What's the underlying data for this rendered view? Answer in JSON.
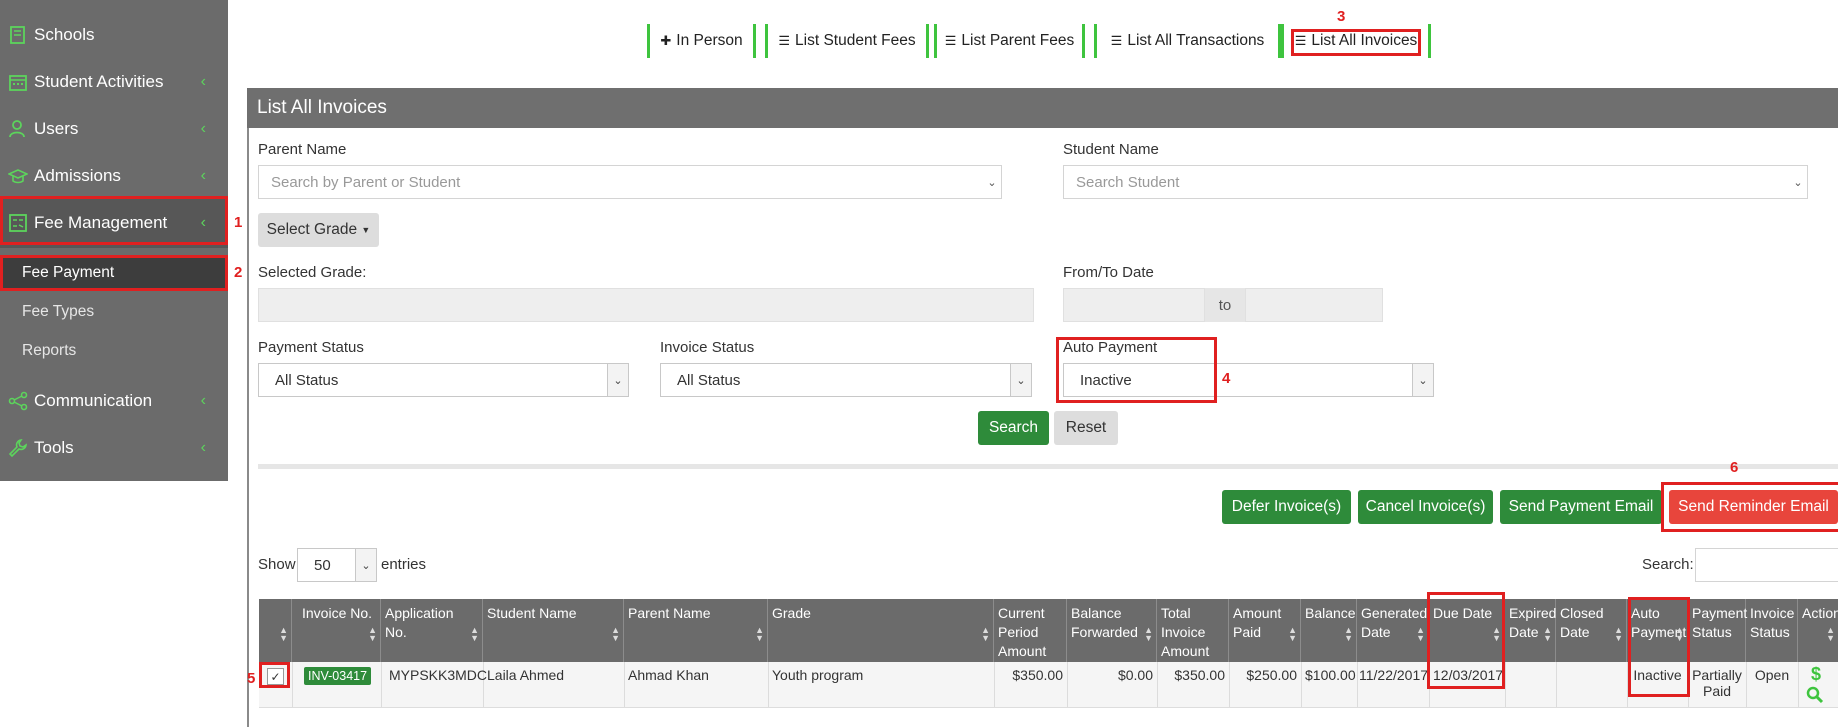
{
  "sidebar": {
    "items": [
      {
        "label": "Schools",
        "icon": "school-icon"
      },
      {
        "label": "Student Activities",
        "icon": "calendar-icon"
      },
      {
        "label": "Users",
        "icon": "users-icon"
      },
      {
        "label": "Admissions",
        "icon": "graduation-cap-icon"
      },
      {
        "label": "Fee Management",
        "icon": "calculator-icon"
      },
      {
        "label": "Communication",
        "icon": "share-icon"
      },
      {
        "label": "Tools",
        "icon": "wrench-icon"
      }
    ],
    "sub_items": [
      "Fee Payment",
      "Fee Types",
      "Reports"
    ]
  },
  "tabs": [
    "In Person",
    "List Student Fees",
    "List Parent Fees",
    "List All Transactions",
    "List All Invoices"
  ],
  "panel_title": "List All Invoices",
  "filters": {
    "parent_name_label": "Parent Name",
    "parent_name_placeholder": "Search by Parent or Student",
    "student_name_label": "Student Name",
    "student_name_placeholder": "Search Student",
    "select_grade_button": "Select Grade",
    "selected_grade_label": "Selected Grade:",
    "date_label": "From/To Date",
    "date_to": "to",
    "payment_status_label": "Payment Status",
    "payment_status_value": "All Status",
    "invoice_status_label": "Invoice Status",
    "invoice_status_value": "All Status",
    "auto_payment_label": "Auto Payment",
    "auto_payment_value": "Inactive",
    "search_button": "Search",
    "reset_button": "Reset"
  },
  "actions": [
    "Defer Invoice(s)",
    "Cancel Invoice(s)",
    "Send Payment Email",
    "Send Reminder Email"
  ],
  "table_controls": {
    "show_label": "Show",
    "entries_value": "50",
    "entries_label": "entries",
    "search_label": "Search:"
  },
  "table": {
    "headers": [
      "",
      "Invoice No.",
      "Application No.",
      "Student Name",
      "Parent Name",
      "Grade",
      "Current Period Amount",
      "Balance Forwarded",
      "Total Invoice Amount",
      "Amount Paid",
      "Balance",
      "Generated Date",
      "Due Date",
      "Expired Date",
      "Closed Date",
      "Auto Payment",
      "Payment Status",
      "Invoice Status",
      "Action"
    ],
    "rows": [
      {
        "invoice_no": "INV-03417",
        "application_no": "MYPSKK3MDC",
        "student_name": "Laila Ahmed",
        "parent_name": "Ahmad Khan",
        "grade": "Youth program",
        "current_period_amount": "$350.00",
        "balance_forwarded": "$0.00",
        "total_invoice_amount": "$350.00",
        "amount_paid": "$250.00",
        "balance": "$100.00",
        "generated_date": "11/22/2017",
        "due_date": "12/03/2017",
        "expired_date": "",
        "closed_date": "",
        "auto_payment": "Inactive",
        "payment_status": "Partially Paid",
        "invoice_status": "Open"
      }
    ]
  },
  "annotations": [
    "1",
    "2",
    "3",
    "4",
    "5",
    "6"
  ],
  "colors": {
    "sidebar": "#6b6b6b",
    "accent_green": "#2e8b3a",
    "icon_green": "#5cd45c",
    "danger": "#e8453c",
    "annotation": "#e02020"
  }
}
